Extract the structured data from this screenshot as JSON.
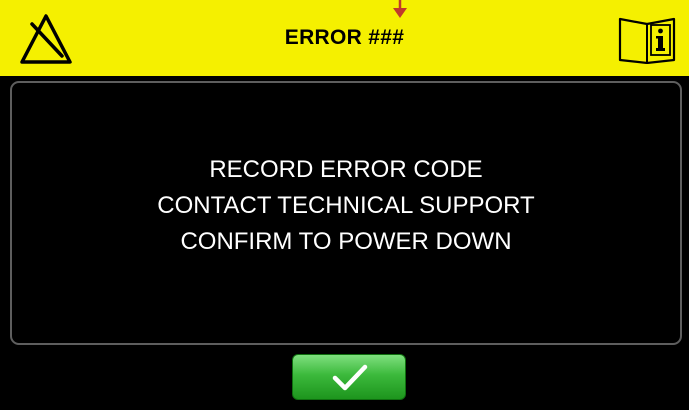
{
  "header": {
    "title": "ERROR ###",
    "warning_icon": "warning-triangle-icon",
    "manual_icon": "info-manual-book-icon"
  },
  "message": {
    "lines": [
      "RECORD ERROR CODE",
      "CONTACT TECHNICAL SUPPORT",
      "CONFIRM TO POWER DOWN"
    ]
  },
  "confirm": {
    "icon": "checkmark-icon"
  },
  "colors": {
    "header_bg": "#f5f000",
    "screen_bg": "#000000",
    "text": "#ffffff",
    "confirm_green": "#3cb93c",
    "pointer_red": "#c0392b"
  }
}
